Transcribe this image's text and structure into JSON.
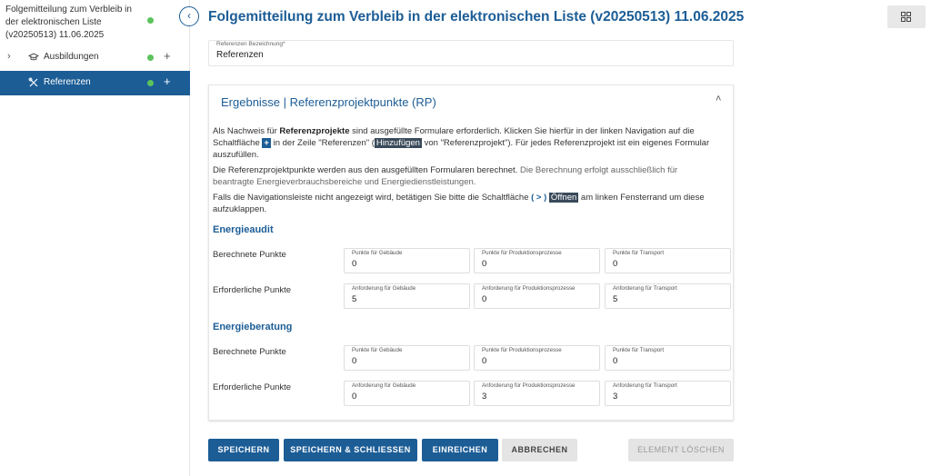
{
  "sidebar": {
    "title": "Folgemitteilung zum Verbleib in der elektronischen Liste (v20250513) 11.06.2025",
    "items": [
      {
        "label": "Ausbildungen",
        "chevron": "›",
        "plus": "+"
      },
      {
        "label": "Referenzen",
        "plus": "+"
      }
    ]
  },
  "header": {
    "title": "Folgemitteilung zum Verbleib in der elektronischen Liste (v20250513) 11.06.2025",
    "collapse_glyph": "‹"
  },
  "ref_field": {
    "label": "Referenzen Bezeichnung*",
    "value": "Referenzen"
  },
  "panel": {
    "title": "Ergebnisse | Referenzprojektpunkte (RP)",
    "chevron": "˄",
    "p1": {
      "a": "Als Nachweis für ",
      "b": "Referenzprojekte",
      "c": " sind ausgefüllte Formulare erforderlich. Klicken Sie hierfür in der linken Navigation auf die Schaltfläche ",
      "plus": "+",
      "d": " in der Zeile \"Referenzen\" (",
      "hinzu": "Hinzufügen",
      "e": " von \"Referenzprojekt\"). Für jedes Referenzprojekt ist ein eigenes Formular auszufüllen."
    },
    "p2": {
      "a": "Die Referenzprojektpunkte werden aus den ausgefüllten Formularen berechnet.",
      "b": " Die Berechnung erfolgt ausschließlich für beantragte Energieverbrauchsbereiche und Energiedienstleistungen."
    },
    "p3": {
      "a": "Falls die Navigationsleiste nicht angezeigt wird, betätigen Sie bitte die Schaltfläche ",
      "b": "( > )",
      "oeffnen": "Öffnen",
      "c": " am linken Fensterrand um diese aufzuklappen."
    },
    "sections": [
      {
        "title": "Energieaudit",
        "rows": [
          {
            "label": "Berechnete Punkte",
            "fields": [
              {
                "label": "Punkte für Gebäude",
                "value": "0"
              },
              {
                "label": "Punkte für Produktionsprozesse",
                "value": "0"
              },
              {
                "label": "Punkte für Transport",
                "value": "0"
              }
            ]
          },
          {
            "label": "Erforderliche Punkte",
            "fields": [
              {
                "label": "Anforderung für Gebäude",
                "value": "5"
              },
              {
                "label": "Anforderung für Produktionsprozesse",
                "value": "0"
              },
              {
                "label": "Anforderung für Transport",
                "value": "5"
              }
            ]
          }
        ]
      },
      {
        "title": "Energieberatung",
        "rows": [
          {
            "label": "Berechnete Punkte",
            "fields": [
              {
                "label": "Punkte für Gebäude",
                "value": "0"
              },
              {
                "label": "Punkte für Produktionsprozesse",
                "value": "0"
              },
              {
                "label": "Punkte für Transport",
                "value": "0"
              }
            ]
          },
          {
            "label": "Erforderliche Punkte",
            "fields": [
              {
                "label": "Anforderung für Gebäude",
                "value": "0"
              },
              {
                "label": "Anforderung für Produktionsprozesse",
                "value": "3"
              },
              {
                "label": "Anforderung für Transport",
                "value": "3"
              }
            ]
          }
        ]
      }
    ]
  },
  "buttons": {
    "save": "SPEICHERN",
    "save_close": "SPEICHERN & SCHLIESSEN",
    "submit": "EINREICHEN",
    "cancel": "ABBRECHEN",
    "delete": "ELEMENT LÖSCHEN"
  },
  "colors": {
    "accent": "#1c5d96",
    "status_dot": "#5cc35c"
  }
}
